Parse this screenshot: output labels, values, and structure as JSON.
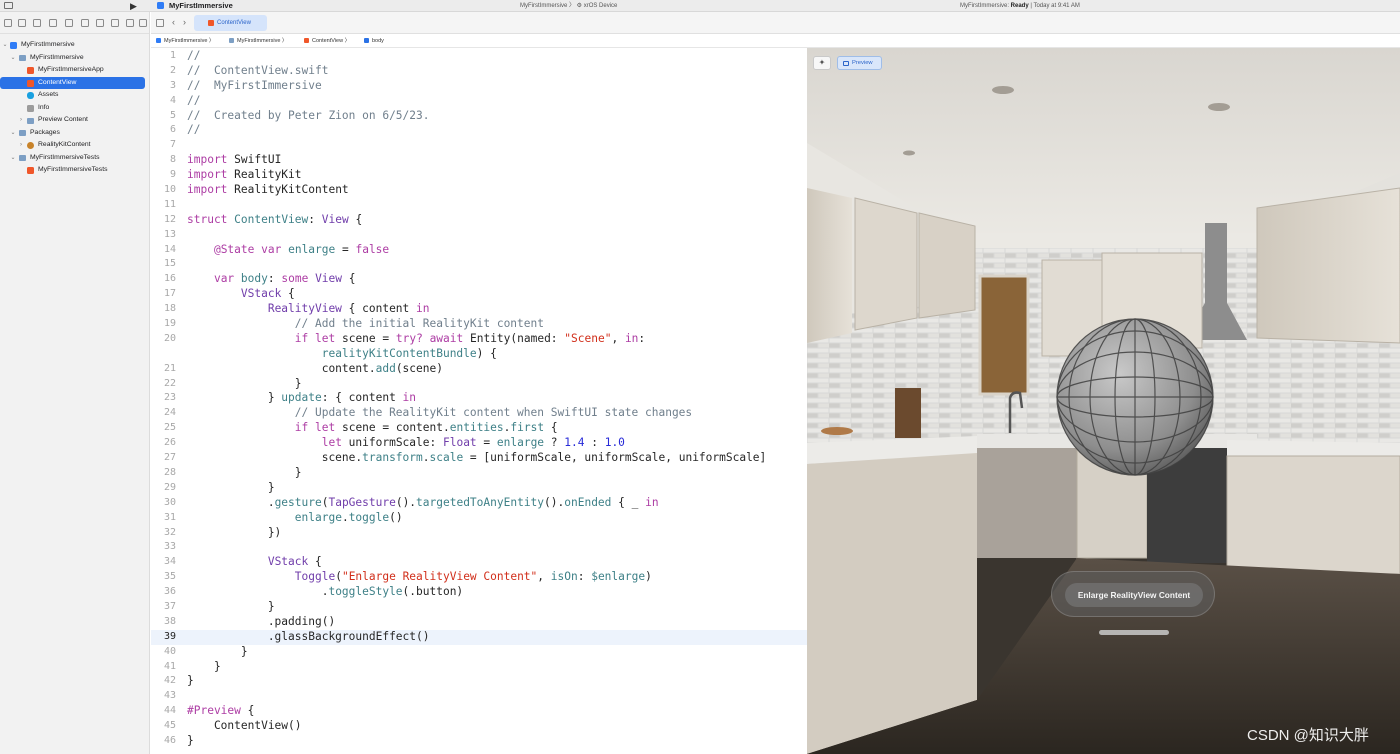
{
  "toolbar": {
    "project_title": "MyFirstImmersive",
    "scheme": "MyFirstImmersive 〉 ⚙ xrOS Device",
    "status_prefix": "MyFirstImmersive: ",
    "status_state": "Ready",
    "status_suffix": " | Today at 9:41 AM"
  },
  "navigator": {
    "items": [
      {
        "label": "MyFirstImmersive"
      },
      {
        "label": "MyFirstImmersive"
      },
      {
        "label": "MyFirstImmersiveApp"
      },
      {
        "label": "ContentView"
      },
      {
        "label": "Assets"
      },
      {
        "label": "Info"
      },
      {
        "label": "Preview Content"
      },
      {
        "label": "Packages"
      },
      {
        "label": "RealityKitContent"
      },
      {
        "label": "MyFirstImmersiveTests"
      },
      {
        "label": "MyFirstImmersiveTests"
      }
    ]
  },
  "editor": {
    "active_tab": "ContentView",
    "breadcrumb": [
      "MyFirstImmersive",
      "MyFirstImmersive",
      "ContentView",
      "body"
    ],
    "current_line": 39,
    "lines": [
      [
        [
          "c",
          "//"
        ]
      ],
      [
        [
          "c",
          "//  ContentView.swift"
        ]
      ],
      [
        [
          "c",
          "//  MyFirstImmersive"
        ]
      ],
      [
        [
          "c",
          "//"
        ]
      ],
      [
        [
          "c",
          "//  Created by Peter Zion on 6/5/23."
        ]
      ],
      [
        [
          "c",
          "//"
        ]
      ],
      [],
      [
        [
          "k",
          "import"
        ],
        [
          "p",
          " SwiftUI"
        ]
      ],
      [
        [
          "k",
          "import"
        ],
        [
          "p",
          " RealityKit"
        ]
      ],
      [
        [
          "k",
          "import"
        ],
        [
          "p",
          " RealityKitContent"
        ]
      ],
      [],
      [
        [
          "k",
          "struct"
        ],
        [
          "p",
          " "
        ],
        [
          "fn",
          "ContentView"
        ],
        [
          "p",
          ": "
        ],
        [
          "ty",
          "View"
        ],
        [
          "p",
          " {"
        ]
      ],
      [],
      [
        [
          "p",
          "    "
        ],
        [
          "k",
          "@State"
        ],
        [
          "p",
          " "
        ],
        [
          "k",
          "var"
        ],
        [
          "p",
          " "
        ],
        [
          "fn",
          "enlarge"
        ],
        [
          "p",
          " = "
        ],
        [
          "k",
          "false"
        ]
      ],
      [],
      [
        [
          "p",
          "    "
        ],
        [
          "k",
          "var"
        ],
        [
          "p",
          " "
        ],
        [
          "fn",
          "body"
        ],
        [
          "p",
          ": "
        ],
        [
          "k",
          "some"
        ],
        [
          "p",
          " "
        ],
        [
          "ty",
          "View"
        ],
        [
          "p",
          " {"
        ]
      ],
      [
        [
          "p",
          "        "
        ],
        [
          "ty",
          "VStack"
        ],
        [
          "p",
          " {"
        ]
      ],
      [
        [
          "p",
          "            "
        ],
        [
          "ty",
          "RealityView"
        ],
        [
          "p",
          " { content "
        ],
        [
          "k",
          "in"
        ]
      ],
      [
        [
          "c",
          "                // Add the initial RealityKit content"
        ]
      ],
      [
        [
          "p",
          "                "
        ],
        [
          "k",
          "if"
        ],
        [
          "p",
          " "
        ],
        [
          "k",
          "let"
        ],
        [
          "p",
          " scene = "
        ],
        [
          "k",
          "try?"
        ],
        [
          "p",
          " "
        ],
        [
          "k",
          "await"
        ],
        [
          "p",
          " Entity(named: "
        ],
        [
          "s",
          "\"Scene\""
        ],
        [
          "p",
          ", "
        ],
        [
          "k",
          "in"
        ],
        [
          "p",
          ":"
        ]
      ],
      [
        [
          "p",
          "                    "
        ],
        [
          "fn",
          "realityKitContentBundle"
        ],
        [
          "p",
          ") {"
        ]
      ],
      [
        [
          "p",
          "                    content."
        ],
        [
          "fn",
          "add"
        ],
        [
          "p",
          "(scene)"
        ]
      ],
      [
        [
          "p",
          "                }"
        ]
      ],
      [
        [
          "p",
          "            } "
        ],
        [
          "fn",
          "update"
        ],
        [
          "p",
          ": { content "
        ],
        [
          "k",
          "in"
        ]
      ],
      [
        [
          "c",
          "                // Update the RealityKit content when SwiftUI state changes"
        ]
      ],
      [
        [
          "p",
          "                "
        ],
        [
          "k",
          "if"
        ],
        [
          "p",
          " "
        ],
        [
          "k",
          "let"
        ],
        [
          "p",
          " scene = content."
        ],
        [
          "fn",
          "entities"
        ],
        [
          "p",
          "."
        ],
        [
          "fn",
          "first"
        ],
        [
          "p",
          " {"
        ]
      ],
      [
        [
          "p",
          "                    "
        ],
        [
          "k",
          "let"
        ],
        [
          "p",
          " uniformScale: "
        ],
        [
          "ty",
          "Float"
        ],
        [
          "p",
          " = "
        ],
        [
          "fn",
          "enlarge"
        ],
        [
          "p",
          " ? "
        ],
        [
          "n",
          "1.4"
        ],
        [
          "p",
          " : "
        ],
        [
          "n",
          "1.0"
        ]
      ],
      [
        [
          "p",
          "                    scene."
        ],
        [
          "fn",
          "transform"
        ],
        [
          "p",
          "."
        ],
        [
          "fn",
          "scale"
        ],
        [
          "p",
          " = [uniformScale, uniformScale, uniformScale]"
        ]
      ],
      [
        [
          "p",
          "                }"
        ]
      ],
      [
        [
          "p",
          "            }"
        ]
      ],
      [
        [
          "p",
          "            ."
        ],
        [
          "fn",
          "gesture"
        ],
        [
          "p",
          "("
        ],
        [
          "ty",
          "TapGesture"
        ],
        [
          "p",
          "()."
        ],
        [
          "fn",
          "targetedToAnyEntity"
        ],
        [
          "p",
          "()."
        ],
        [
          "fn",
          "onEnded"
        ],
        [
          "p",
          " { _ "
        ],
        [
          "k",
          "in"
        ]
      ],
      [
        [
          "p",
          "                "
        ],
        [
          "fn",
          "enlarge"
        ],
        [
          "p",
          "."
        ],
        [
          "fn",
          "toggle"
        ],
        [
          "p",
          "()"
        ]
      ],
      [
        [
          "p",
          "            })"
        ]
      ],
      [],
      [
        [
          "p",
          "            "
        ],
        [
          "ty",
          "VStack"
        ],
        [
          "p",
          " {"
        ]
      ],
      [
        [
          "p",
          "                "
        ],
        [
          "ty",
          "Toggle"
        ],
        [
          "p",
          "("
        ],
        [
          "s",
          "\"Enlarge RealityView Content\""
        ],
        [
          "p",
          ", "
        ],
        [
          "fn",
          "isOn"
        ],
        [
          "p",
          ": "
        ],
        [
          "fn",
          "$enlarge"
        ],
        [
          "p",
          ")"
        ]
      ],
      [
        [
          "p",
          "                    ."
        ],
        [
          "fn",
          "toggleStyle"
        ],
        [
          "p",
          "(.button)"
        ]
      ],
      [
        [
          "p",
          "            }"
        ]
      ],
      [
        [
          "p",
          "            .padding()"
        ]
      ],
      [
        [
          "p",
          "            .glassBackgroundEffect()"
        ]
      ],
      [
        [
          "p",
          "        }"
        ]
      ],
      [
        [
          "p",
          "    }"
        ]
      ],
      [
        [
          "p",
          "}"
        ]
      ],
      [],
      [
        [
          "k",
          "#Preview"
        ],
        [
          "p",
          " {"
        ]
      ],
      [
        [
          "p",
          "    ContentView()"
        ]
      ],
      [
        [
          "p",
          "}"
        ]
      ]
    ],
    "line_numbers": [
      "1",
      "2",
      "3",
      "4",
      "5",
      "6",
      "7",
      "8",
      "9",
      "10",
      "11",
      "12",
      "13",
      "14",
      "15",
      "16",
      "17",
      "18",
      "19",
      "20",
      "",
      "21",
      "22",
      "23",
      "24",
      "25",
      "26",
      "27",
      "28",
      "29",
      "30",
      "31",
      "32",
      "33",
      "34",
      "35",
      "36",
      "37",
      "38",
      "39",
      "40",
      "41",
      "42",
      "43",
      "44",
      "45",
      "46"
    ]
  },
  "preview": {
    "preview_label": "Preview",
    "toggle_label": "Enlarge RealityView Content",
    "watermark": "CSDN @知识大胖"
  },
  "colors": {
    "accent": "#2b72e6",
    "keyword": "#ad3da4",
    "type": "#703daa",
    "identifier": "#3e8087",
    "string": "#d12f1b",
    "comment": "#707f8c",
    "number": "#272ad8"
  }
}
